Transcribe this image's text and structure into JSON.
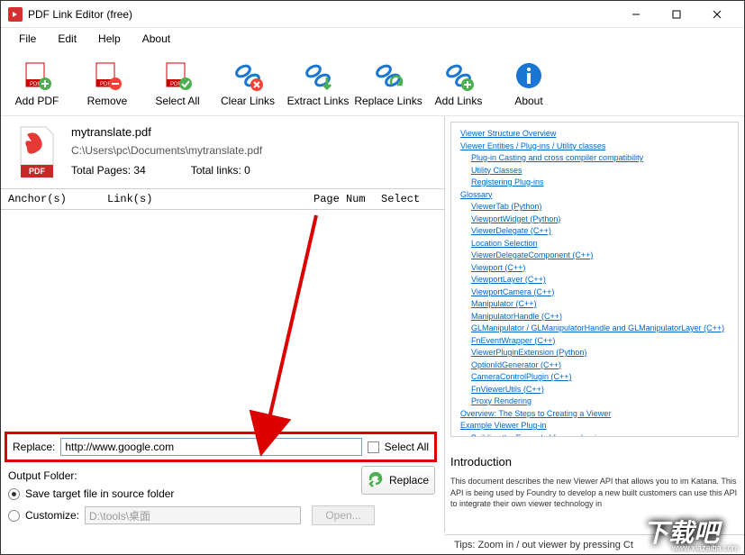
{
  "window": {
    "title": "PDF Link Editor (free)"
  },
  "menu": {
    "file": "File",
    "edit": "Edit",
    "help": "Help",
    "about": "About"
  },
  "toolbar": {
    "add_pdf": "Add PDF",
    "remove": "Remove",
    "select_all": "Select All",
    "clear_links": "Clear Links",
    "extract_links": "Extract Links",
    "replace_links": "Replace Links",
    "add_links": "Add Links",
    "about": "About"
  },
  "file": {
    "name": "mytranslate.pdf",
    "path": "C:\\Users\\pc\\Documents\\mytranslate.pdf",
    "total_pages_label": "Total Pages:",
    "total_pages": "34",
    "total_links_label": "Total links:",
    "total_links": "0"
  },
  "columns": {
    "anchor": "Anchor(s)",
    "links": "Link(s)",
    "page": "Page Num",
    "select": "Select"
  },
  "replace": {
    "label": "Replace:",
    "value": "http://www.google.com",
    "select_all": "Select All"
  },
  "output": {
    "title": "Output Folder:",
    "save_source": "Save target file in source folder",
    "customize": "Customize:",
    "path": "D:\\tools\\桌面",
    "open": "Open...",
    "replace_btn": "Replace"
  },
  "right_links": [
    {
      "text": "Viewer Structure Overview",
      "indent": 0
    },
    {
      "text": "Viewer Entities / Plug-ins / Utility classes",
      "indent": 0
    },
    {
      "text": "Plug-in Casting and cross compiler compatibility",
      "indent": 1
    },
    {
      "text": "Utility Classes",
      "indent": 1
    },
    {
      "text": "Registering Plug-ins",
      "indent": 1
    },
    {
      "text": "Glossary",
      "indent": 0
    },
    {
      "text": "ViewerTab (Python)",
      "indent": 1
    },
    {
      "text": "ViewportWidget (Python)",
      "indent": 1
    },
    {
      "text": "ViewerDelegate (C++)",
      "indent": 1
    },
    {
      "text": "Location Selection",
      "indent": 1
    },
    {
      "text": "ViewerDelegateComponent (C++)",
      "indent": 1
    },
    {
      "text": "Viewport (C++)",
      "indent": 1
    },
    {
      "text": "ViewportLayer (C++)",
      "indent": 1
    },
    {
      "text": "ViewportCamera (C++)",
      "indent": 1
    },
    {
      "text": "Manipulator (C++)",
      "indent": 1
    },
    {
      "text": "ManipulatorHandle (C++)",
      "indent": 1
    },
    {
      "text": "GLManipulator / GLManipulatorHandle and GLManipulatorLayer (C++)",
      "indent": 1
    },
    {
      "text": "FnEventWrapper (C++)",
      "indent": 1
    },
    {
      "text": "ViewerPluginExtension (Python)",
      "indent": 1
    },
    {
      "text": "OptionIdGenerator (C++)",
      "indent": 1
    },
    {
      "text": "CameraControlPlugin (C++)",
      "indent": 1
    },
    {
      "text": "FnViewerUtils (C++)",
      "indent": 1
    },
    {
      "text": "Proxy Rendering",
      "indent": 1
    },
    {
      "text": "Overview: The Steps to Creating a Viewer",
      "indent": 0
    },
    {
      "text": "Example Viewer Plug-in",
      "indent": 0
    },
    {
      "text": "Building the Example Viewer plug-in",
      "indent": 1
    }
  ],
  "intro": {
    "title": "Introduction",
    "text": "This document describes the new Viewer API that allows you to im Katana. This API is being used by Foundry to develop a new built customers can use this API to integrate their own viewer technology in"
  },
  "status": {
    "tip": "Tips: Zoom in / out viewer by pressing Ct"
  },
  "watermark": {
    "text": "下载吧",
    "url": "www.xiazaiba.com"
  }
}
